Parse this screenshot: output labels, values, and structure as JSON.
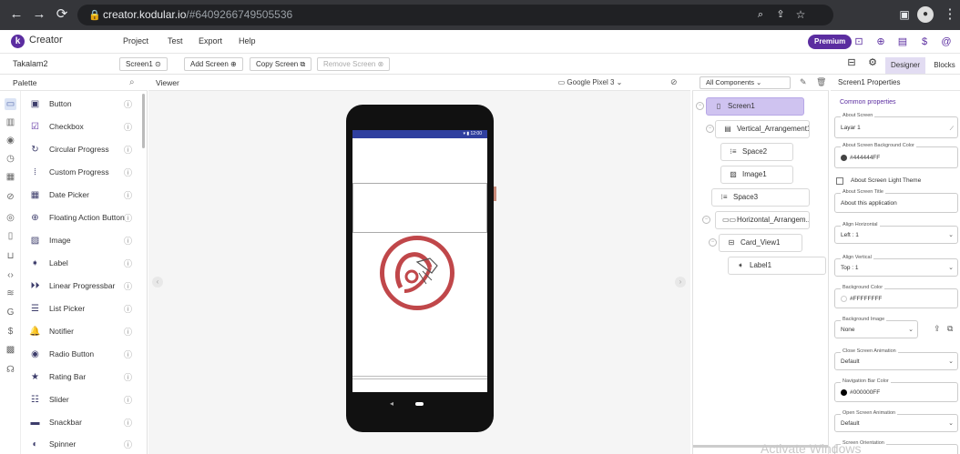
{
  "browser": {
    "url_host": "creator.kodular.io",
    "url_path": "/#6409266749505536",
    "icons": [
      "back-icon",
      "forward-icon",
      "reload-icon",
      "lock-icon",
      "zoom-icon",
      "share-icon",
      "star-icon",
      "extension-icon",
      "profile-icon",
      "kebab-menu-icon"
    ]
  },
  "app": {
    "brand": "Creator",
    "menu": [
      "Project",
      "Test",
      "Export",
      "Help"
    ],
    "premium": "Premium",
    "accent": "#5b2da0"
  },
  "toolbar": {
    "project_name": "Takalam2",
    "screen_select": "Screen1",
    "add_screen": "Add Screen",
    "copy_screen": "Copy Screen",
    "remove_screen": "Remove Screen",
    "designer": "Designer",
    "blocks": "Blocks"
  },
  "palette": {
    "title": "Palette",
    "items": [
      {
        "label": "Button",
        "icon": "button-icon"
      },
      {
        "label": "Checkbox",
        "icon": "checkbox-icon"
      },
      {
        "label": "Circular Progress",
        "icon": "circular-progress-icon"
      },
      {
        "label": "Custom Progress",
        "icon": "custom-progress-icon"
      },
      {
        "label": "Date Picker",
        "icon": "date-picker-icon"
      },
      {
        "label": "Floating Action Button",
        "icon": "fab-icon"
      },
      {
        "label": "Image",
        "icon": "image-icon"
      },
      {
        "label": "Label",
        "icon": "label-icon"
      },
      {
        "label": "Linear Progressbar",
        "icon": "linear-progress-icon"
      },
      {
        "label": "List Picker",
        "icon": "list-picker-icon"
      },
      {
        "label": "Notifier",
        "icon": "notifier-icon"
      },
      {
        "label": "Radio Button",
        "icon": "radio-button-icon"
      },
      {
        "label": "Rating Bar",
        "icon": "rating-bar-icon"
      },
      {
        "label": "Slider",
        "icon": "slider-icon"
      },
      {
        "label": "Snackbar",
        "icon": "snackbar-icon"
      },
      {
        "label": "Spinner",
        "icon": "spinner-icon"
      }
    ]
  },
  "viewer": {
    "title": "Viewer",
    "device": "Google Pixel 3",
    "status_time": "12:00"
  },
  "components": {
    "filter": "All Components",
    "nodes": [
      {
        "label": "Screen1",
        "icon": "phone-icon"
      },
      {
        "label": "Vertical_Arrangement1",
        "icon": "vertical-arrangement-icon"
      },
      {
        "label": "Space2",
        "icon": "space-icon"
      },
      {
        "label": "Image1",
        "icon": "image-icon"
      },
      {
        "label": "Space3",
        "icon": "space-icon"
      },
      {
        "label": "Horizontal_Arrangem...",
        "icon": "horizontal-arrangement-icon"
      },
      {
        "label": "Card_View1",
        "icon": "card-view-icon"
      },
      {
        "label": "Label1",
        "icon": "label-icon"
      }
    ]
  },
  "properties": {
    "title": "Screen1 Properties",
    "section": "Common properties",
    "about_screen_label": "About Screen",
    "about_screen_value": "Layar 1",
    "bg_color_label": "About Screen Background Color",
    "bg_color_value": "#444444FF",
    "bg_color_hex": "#444444",
    "light_theme_label": "About Screen Light Theme",
    "title_label": "About Screen Title",
    "title_value": "About this application",
    "align_h_label": "Align Horizontal",
    "align_h_value": "Left : 1",
    "align_v_label": "Align Vertical",
    "align_v_value": "Top : 1",
    "background_color_label": "Background Color",
    "background_color_value": "#FFFFFFFF",
    "background_image_label": "Background Image",
    "background_image_value": "None",
    "close_anim_label": "Close Screen Animation",
    "close_anim_value": "Default",
    "navbar_color_label": "Navigation Bar Color",
    "navbar_color_value": "#000000FF",
    "open_anim_label": "Open Screen Animation",
    "open_anim_value": "Default",
    "orientation_label": "Screen Orientation"
  },
  "watermark": "Activate Windows"
}
